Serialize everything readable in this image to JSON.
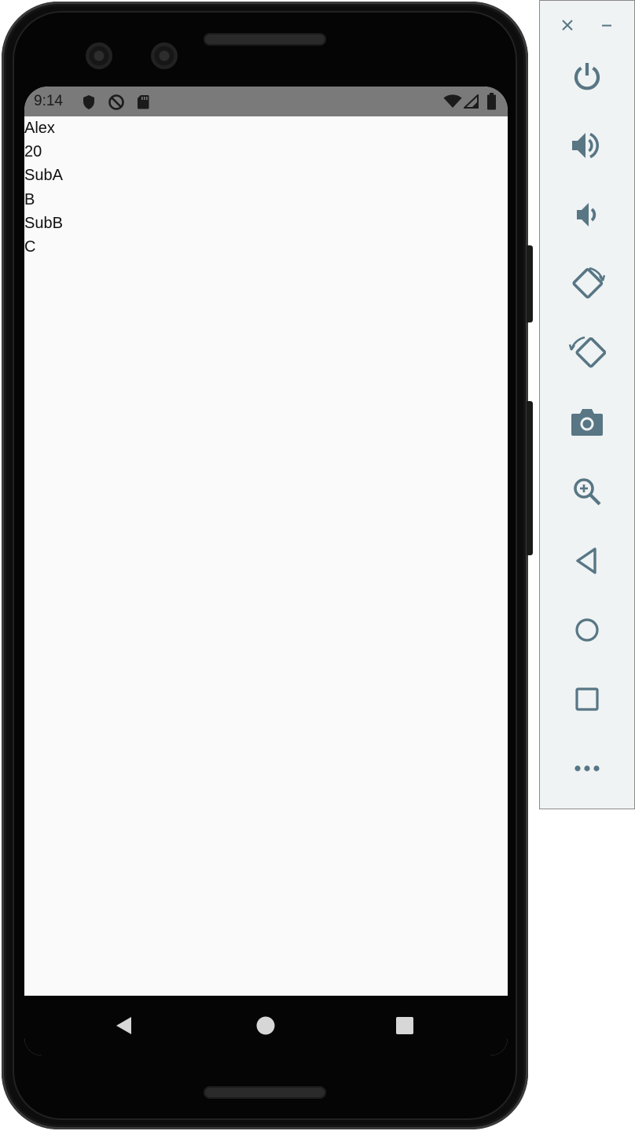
{
  "status_bar": {
    "time": "9:14",
    "left_icons": [
      "shield-icon",
      "no-sync-icon",
      "sd-card-icon"
    ],
    "right_icons": [
      "wifi-icon",
      "signal-icon",
      "battery-icon"
    ],
    "background": "#7a7a7a"
  },
  "app": {
    "lines": [
      "Alex",
      "20",
      "SubA",
      "B",
      "SubB",
      "C"
    ],
    "background": "#fafafa"
  },
  "nav_bar": {
    "buttons": [
      "back-icon",
      "home-icon",
      "recents-icon"
    ]
  },
  "emulator_toolbar": {
    "window_controls": [
      "close-icon",
      "minimize-icon"
    ],
    "buttons": [
      "power-icon",
      "volume-up-icon",
      "volume-down-icon",
      "rotate-left-icon",
      "rotate-right-icon",
      "camera-icon",
      "zoom-icon",
      "back-icon",
      "home-icon",
      "overview-icon",
      "more-icon"
    ],
    "icon_color": "#587684"
  }
}
